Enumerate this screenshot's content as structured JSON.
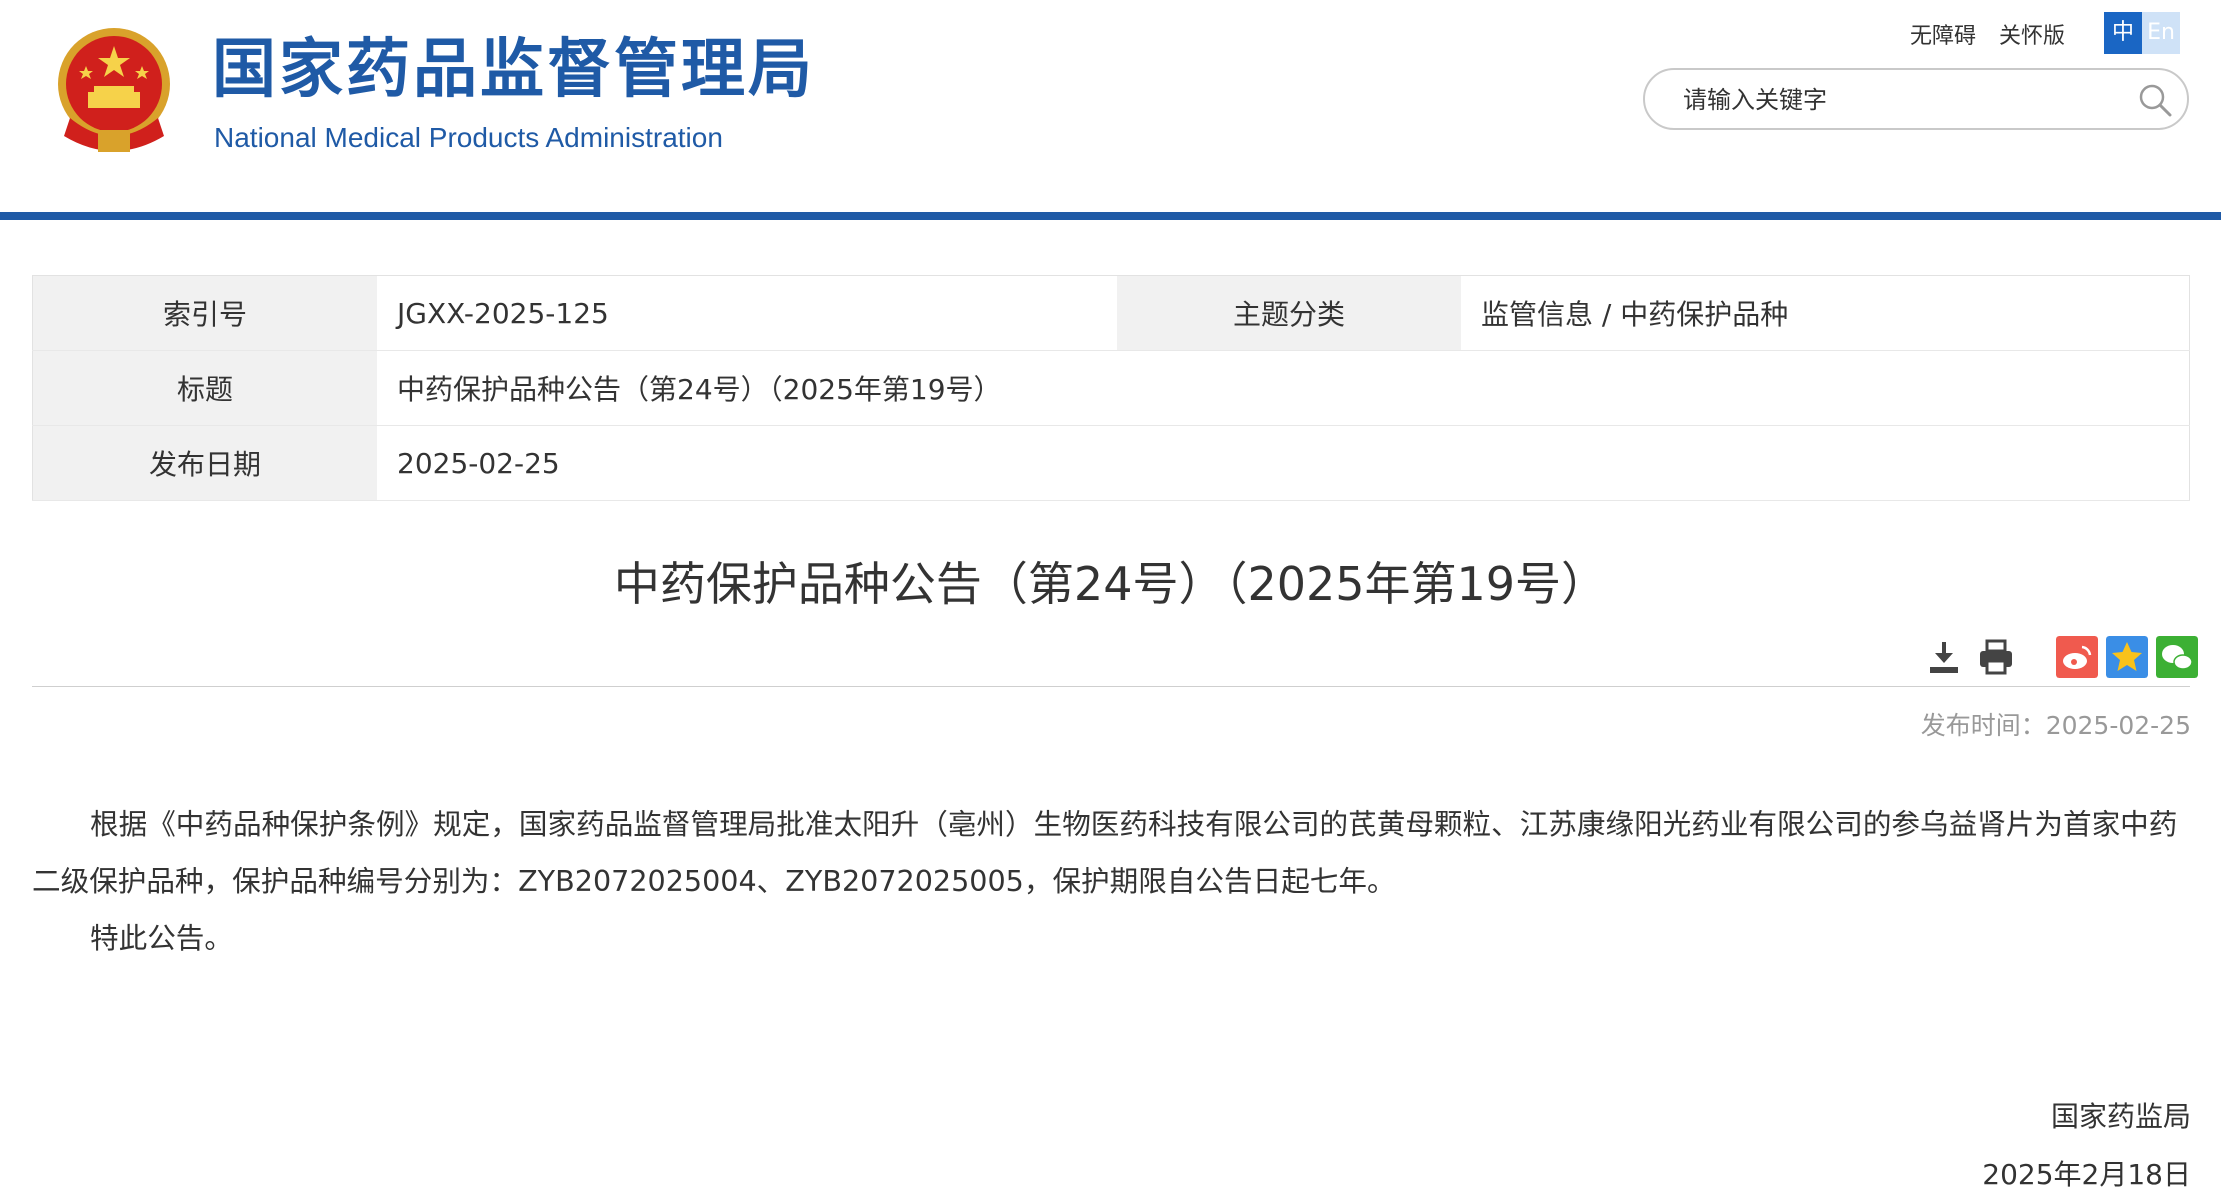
{
  "header": {
    "site_name_cn": "国家药品监督管理局",
    "site_name_en": "National Medical Products Administration",
    "accessibility_link": "无障碍",
    "care_mode_link": "关怀版",
    "lang_zh": "中",
    "lang_en": "En",
    "search_placeholder": "请输入关键字",
    "brand_color": "#1f5aa6",
    "social_icons": [
      "weibo-icon",
      "wechat-icon",
      "mobile-icon",
      "mail-icon",
      "user-icon"
    ]
  },
  "meta": {
    "index_label": "索引号",
    "index_value": "JGXX-2025-125",
    "category_label": "主题分类",
    "category_value": "监管信息 / 中药保护品种",
    "title_label": "标题",
    "title_value": "中药保护品种公告（第24号）（2025年第19号）",
    "date_label": "发布日期",
    "date_value": "2025-02-25"
  },
  "article": {
    "title": "中药保护品种公告（第24号）（2025年第19号）",
    "pub_time": "发布时间：2025-02-25",
    "paragraphs": [
      "根据《中药品种保护条例》规定，国家药品监督管理局批准太阳升（亳州）生物医药科技有限公司的芪黄母颗粒、江苏康缘阳光药业有限公司的参乌益肾片为首家中药二级保护品种，保护品种编号分别为：ZYB2072025004、ZYB2072025005，保护期限自公告日起七年。",
      "特此公告。"
    ],
    "signature_org": "国家药监局",
    "signature_date": "2025年2月18日",
    "tool_icons": [
      "download-icon",
      "print-icon",
      "weibo-share-icon",
      "favorite-star-icon",
      "wechat-share-icon"
    ]
  }
}
